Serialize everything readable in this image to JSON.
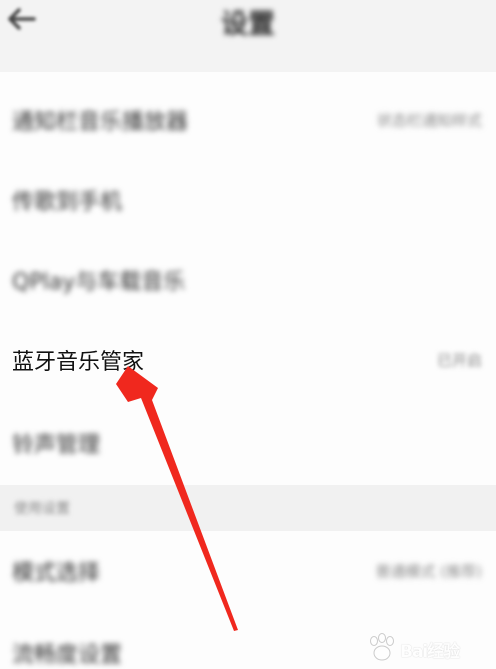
{
  "header": {
    "title": "设置"
  },
  "settings": {
    "rows": [
      {
        "label": "通知栏音乐播放器",
        "value": "状态栏通知样式"
      },
      {
        "label": "传歌到手机",
        "value": ""
      },
      {
        "label": "QPlay与车载音乐",
        "value": ""
      },
      {
        "label": "蓝牙音乐管家",
        "value": "已开启"
      },
      {
        "label": "铃声管理",
        "value": ""
      }
    ],
    "section_label": "使用设置",
    "rows2": [
      {
        "label": "模式选择",
        "value": "普通模式 (推荐)"
      },
      {
        "label": "流畅度设置",
        "value": ""
      }
    ]
  },
  "watermark": {
    "text": "Bai经验"
  },
  "colors": {
    "annotation_arrow": "#f0281e",
    "header_bg": "#f3f3f3",
    "section_bg": "#f1f1f1"
  }
}
